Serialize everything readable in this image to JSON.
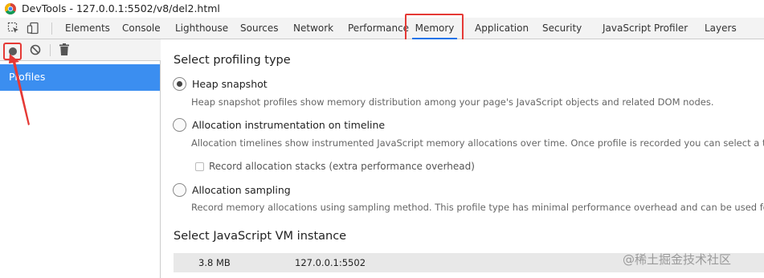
{
  "window": {
    "title": "DevTools - 127.0.0.1:5502/v8/del2.html"
  },
  "tabs": [
    {
      "label": "Elements"
    },
    {
      "label": "Console"
    },
    {
      "label": "Lighthouse"
    },
    {
      "label": "Sources"
    },
    {
      "label": "Network"
    },
    {
      "label": "Performance"
    },
    {
      "label": "Memory",
      "active": true
    },
    {
      "label": "Application"
    },
    {
      "label": "Security"
    },
    {
      "label": "JavaScript Profiler"
    },
    {
      "label": "Layers"
    }
  ],
  "toolbar_icons": [
    "inspect-element-icon",
    "device-toolbar-icon"
  ],
  "left_toolbar_icons": [
    "record-icon",
    "clear-icon",
    "trash-icon"
  ],
  "sidebar": {
    "profiles_label": "Profiles"
  },
  "main": {
    "select_type_title": "Select profiling type",
    "options": [
      {
        "label": "Heap snapshot",
        "checked": true,
        "desc": "Heap snapshot profiles show memory distribution among your page's JavaScript objects and related DOM nodes."
      },
      {
        "label": "Allocation instrumentation on timeline",
        "checked": false,
        "desc": "Allocation timelines show instrumented JavaScript memory allocations over time. Once profile is recorded you can select a time interval"
      },
      {
        "label": "Allocation sampling",
        "checked": false,
        "desc": "Record memory allocations using sampling method. This profile type has minimal performance overhead and can be used for long runn"
      }
    ],
    "record_stacks_label": "Record allocation stacks (extra performance overhead)",
    "record_stacks_checked": false,
    "vm_title": "Select JavaScript VM instance",
    "vm_instance": {
      "size": "3.8 MB",
      "host": "127.0.0.1:5502"
    }
  },
  "watermark": "@稀土掘金技术社区",
  "colors": {
    "highlight": "#e53935",
    "selection": "#3b8ef0",
    "active_tab_underline": "#1a73e8"
  }
}
